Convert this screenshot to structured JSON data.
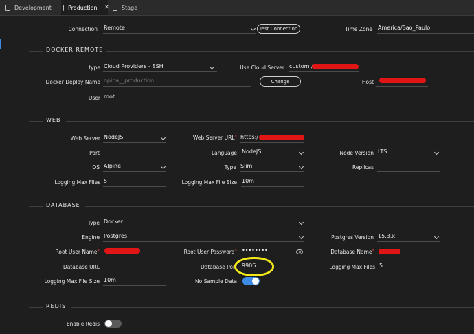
{
  "tabs": [
    {
      "label": "Development",
      "active": false
    },
    {
      "label": "Production",
      "active": true
    },
    {
      "label": "Stage",
      "active": false
    }
  ],
  "tab_close": "✕",
  "top": {
    "connection_label": "Connection",
    "connection_value": "Remote",
    "test_connection_label": "Test Connection",
    "timezone_label": "Time Zone",
    "timezone_value": "America/Sao_Paulo"
  },
  "docker_remote": {
    "title": "DOCKER REMOTE",
    "type_label": "type",
    "type_value": "Cloud Providers - SSH",
    "use_cloud_server_label": "Use Cloud Server",
    "use_cloud_server_value": "custom /",
    "deploy_name_label": "Docker Deploy Name",
    "deploy_name_placeholder": "opina__production",
    "change_label": "Change",
    "host_label": "Host",
    "user_label": "User",
    "user_value": "root"
  },
  "web": {
    "title": "WEB",
    "web_server_label": "Web Server",
    "web_server_value": "NodeJS",
    "web_server_url_label": "Web Server URL",
    "web_server_url_value": "https:/",
    "port_label": "Port",
    "port_value": "",
    "language_label": "Language",
    "language_value": "NodeJS",
    "node_version_label": "Node Version",
    "node_version_value": "LTS",
    "os_label": "OS",
    "os_value": "Alpine",
    "type_label": "Type",
    "type_value": "Slim",
    "replicas_label": "Replicas",
    "replicas_value": "",
    "logging_max_files_label": "Logging Max Files",
    "logging_max_files_value": "5",
    "logging_max_file_size_label": "Logging Max File Size",
    "logging_max_file_size_value": "10m"
  },
  "database": {
    "title": "DATABASE",
    "type_label": "Type",
    "type_value": "Docker",
    "engine_label": "Engine",
    "engine_value": "Postgres",
    "postgres_version_label": "Postgres Version",
    "postgres_version_value": "15.3.x",
    "root_user_name_label": "Root User Name",
    "root_user_password_label": "Root User Password",
    "root_user_password_value": "••••••••",
    "database_name_label": "Database Name",
    "database_url_label": "Database URL",
    "database_port_label": "Database Port",
    "database_port_value": "9906",
    "logging_max_files_label": "Logging Max Files",
    "logging_max_files_value": "5",
    "logging_max_file_size_label": "Logging Max File Size",
    "logging_max_file_size_value": "10m",
    "no_sample_data_label": "No Sample Data",
    "no_sample_data_on": true
  },
  "redis": {
    "title": "REDIS",
    "enable_redis_label": "Enable Redis",
    "enable_redis_on": false
  },
  "colors": {
    "background": "#1e1e1e",
    "toggle_on": "#3d8be6",
    "toggle_off": "#5a5a5a",
    "required": "#e53b3b",
    "annotation": "#f2e81a"
  },
  "required_mark": "*"
}
